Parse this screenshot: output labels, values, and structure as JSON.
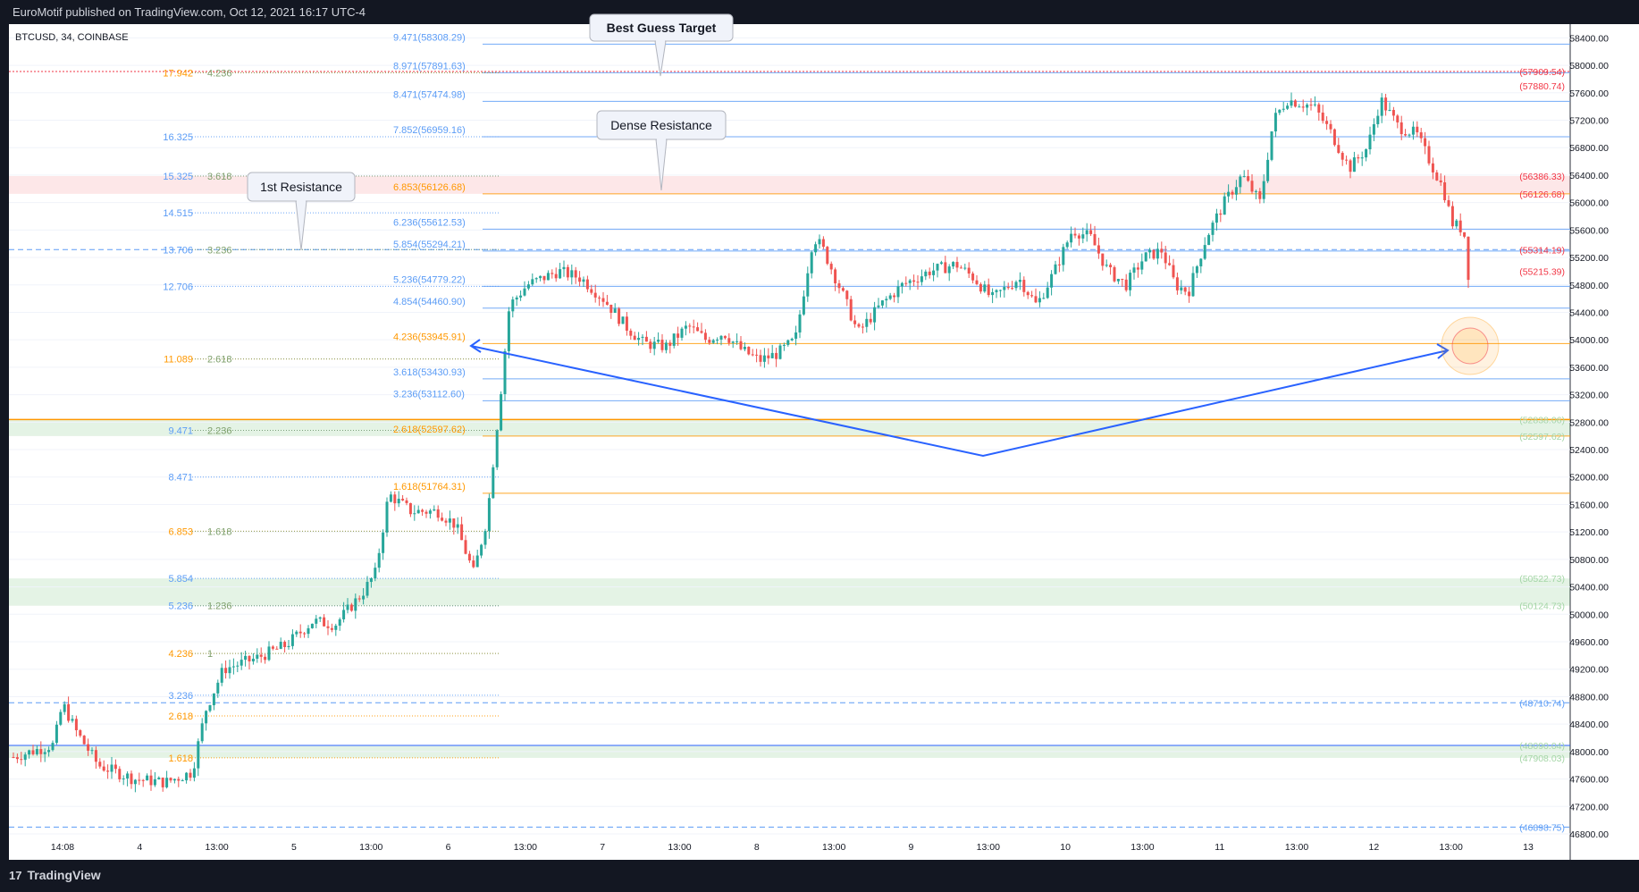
{
  "header": {
    "published": "EuroMotif published on TradingView.com, Oct 12, 2021 16:17 UTC-4"
  },
  "footer": {
    "brand": "TradingView",
    "logo_mark": "17"
  },
  "chart_data": {
    "type": "candlestick",
    "symbol_label": "BTCUSD, 34, COINBASE",
    "ylim": [
      46800,
      58600
    ],
    "y_ticks": [
      "58400.00",
      "58000.00",
      "57600.00",
      "57200.00",
      "56800.00",
      "56400.00",
      "56000.00",
      "55600.00",
      "55200.00",
      "54800.00",
      "54400.00",
      "54000.00",
      "53600.00",
      "53200.00",
      "52800.00",
      "52400.00",
      "52000.00",
      "51600.00",
      "51200.00",
      "50800.00",
      "50400.00",
      "50000.00",
      "49600.00",
      "49200.00",
      "48800.00",
      "48400.00",
      "48000.00",
      "47600.00",
      "47200.00",
      "46800.00"
    ],
    "x_ticks": [
      "14:08",
      "4",
      "13:00",
      "5",
      "13:00",
      "6",
      "13:00",
      "7",
      "13:00",
      "8",
      "13:00",
      "9",
      "13:00",
      "10",
      "13:00",
      "11",
      "13:00",
      "12",
      "13:00",
      "13"
    ],
    "fib_labels": [
      {
        "text": "9.471(58308.29)",
        "price": 58308.29,
        "color": "#5b9cf6"
      },
      {
        "text": "8.971(57891.63)",
        "price": 57891.63,
        "color": "#5b9cf6"
      },
      {
        "text": "8.471(57474.98)",
        "price": 57474.98,
        "color": "#5b9cf6"
      },
      {
        "text": "7.852(56959.16)",
        "price": 56959.16,
        "color": "#5b9cf6"
      },
      {
        "text": "6.853(56126.68)",
        "price": 56126.68,
        "color": "#ff9800"
      },
      {
        "text": "6.236(55612.53)",
        "price": 55612.53,
        "color": "#5b9cf6"
      },
      {
        "text": "5.854(55294.21)",
        "price": 55294.21,
        "color": "#5b9cf6"
      },
      {
        "text": "5.236(54779.22)",
        "price": 54779.22,
        "color": "#5b9cf6"
      },
      {
        "text": "4.854(54460.90)",
        "price": 54460.9,
        "color": "#5b9cf6"
      },
      {
        "text": "4.236(53945.91)",
        "price": 53945.91,
        "color": "#ff9800"
      },
      {
        "text": "3.618(53430.93)",
        "price": 53430.93,
        "color": "#5b9cf6"
      },
      {
        "text": "3.236(53112.60)",
        "price": 53112.6,
        "color": "#5b9cf6"
      },
      {
        "text": "2.618(52597.62)",
        "price": 52597.62,
        "color": "#ff9800"
      },
      {
        "text": "1.618(51764.31)",
        "price": 51764.31,
        "color": "#ff9800"
      }
    ],
    "left_fib_labels": [
      {
        "text": "17.942",
        "price": 57891.63,
        "color": "#ff9800"
      },
      {
        "text": "4.236",
        "price": 57891.63,
        "color": "#7fa06d"
      },
      {
        "text": "16.325",
        "price": 56959.16,
        "color": "#5b9cf6"
      },
      {
        "text": "15.325",
        "price": 56386.33,
        "color": "#5b9cf6"
      },
      {
        "text": "3.618",
        "price": 56386.33,
        "color": "#7fa06d"
      },
      {
        "text": "14.515",
        "price": 55850,
        "color": "#5b9cf6"
      },
      {
        "text": "13.706",
        "price": 55314.19,
        "color": "#5b9cf6"
      },
      {
        "text": "3.236",
        "price": 55314.19,
        "color": "#7fa06d"
      },
      {
        "text": "12.706",
        "price": 54779.22,
        "color": "#5b9cf6"
      },
      {
        "text": "11.089",
        "price": 53720,
        "color": "#ff9800"
      },
      {
        "text": "2.618",
        "price": 53720,
        "color": "#7fa06d"
      },
      {
        "text": "9.471",
        "price": 52680,
        "color": "#5b9cf6"
      },
      {
        "text": "2.236",
        "price": 52680,
        "color": "#7fa06d"
      },
      {
        "text": "8.471",
        "price": 52000,
        "color": "#5b9cf6"
      },
      {
        "text": "6.853",
        "price": 51210,
        "color": "#ff9800"
      },
      {
        "text": "1.618",
        "price": 51210,
        "color": "#7fa06d"
      },
      {
        "text": "5.854",
        "price": 50522.73,
        "color": "#5b9cf6"
      },
      {
        "text": "5.236",
        "price": 50124.73,
        "color": "#5b9cf6"
      },
      {
        "text": "1.236",
        "price": 50124.73,
        "color": "#7fa06d"
      },
      {
        "text": "4.236",
        "price": 49430,
        "color": "#ff9800"
      },
      {
        "text": "1",
        "price": 49430,
        "color": "#7fa06d"
      },
      {
        "text": "3.236",
        "price": 48820,
        "color": "#5b9cf6"
      },
      {
        "text": "2.618",
        "price": 48520,
        "color": "#ff9800"
      },
      {
        "text": "1.618",
        "price": 47908.03,
        "color": "#ff9800"
      }
    ],
    "right_price_labels": [
      {
        "text": "(57909.54)",
        "price": 57909.54,
        "color": "#f23645"
      },
      {
        "text": "(57880.74)",
        "price": 57700,
        "color": "#f23645"
      },
      {
        "text": "(56386.33)",
        "price": 56386.33,
        "color": "#f23645"
      },
      {
        "text": "(56126.68)",
        "price": 56126.68,
        "color": "#f23645"
      },
      {
        "text": "(55314.19)",
        "price": 55314.19,
        "color": "#f23645"
      },
      {
        "text": "(55215.39)",
        "price": 55000,
        "color": "#f23645"
      },
      {
        "text": "(52838.06)",
        "price": 52838.06,
        "color": "#a5d6a7"
      },
      {
        "text": "(52597.62)",
        "price": 52597.62,
        "color": "#a5d6a7"
      },
      {
        "text": "(50522.73)",
        "price": 50522.73,
        "color": "#a5d6a7"
      },
      {
        "text": "(50124.73)",
        "price": 50124.73,
        "color": "#a5d6a7"
      },
      {
        "text": "(48710.74)",
        "price": 48710.74,
        "color": "#5b9cf6"
      },
      {
        "text": "(48090.04)",
        "price": 48090.04,
        "color": "#a5d6a7"
      },
      {
        "text": "(47908.03)",
        "price": 47908.03,
        "color": "#a5d6a7"
      },
      {
        "text": "(46898.75)",
        "price": 46898.75,
        "color": "#5b9cf6"
      }
    ],
    "annotations": [
      "Best Guess Target",
      "Dense Resistance",
      "1st Resistance"
    ],
    "colors": {
      "up": "#26a69a",
      "down": "#ef5350",
      "arrow": "#2962ff",
      "background": "#131722",
      "grid": "#1e222d",
      "text": "#b2b5be"
    }
  }
}
